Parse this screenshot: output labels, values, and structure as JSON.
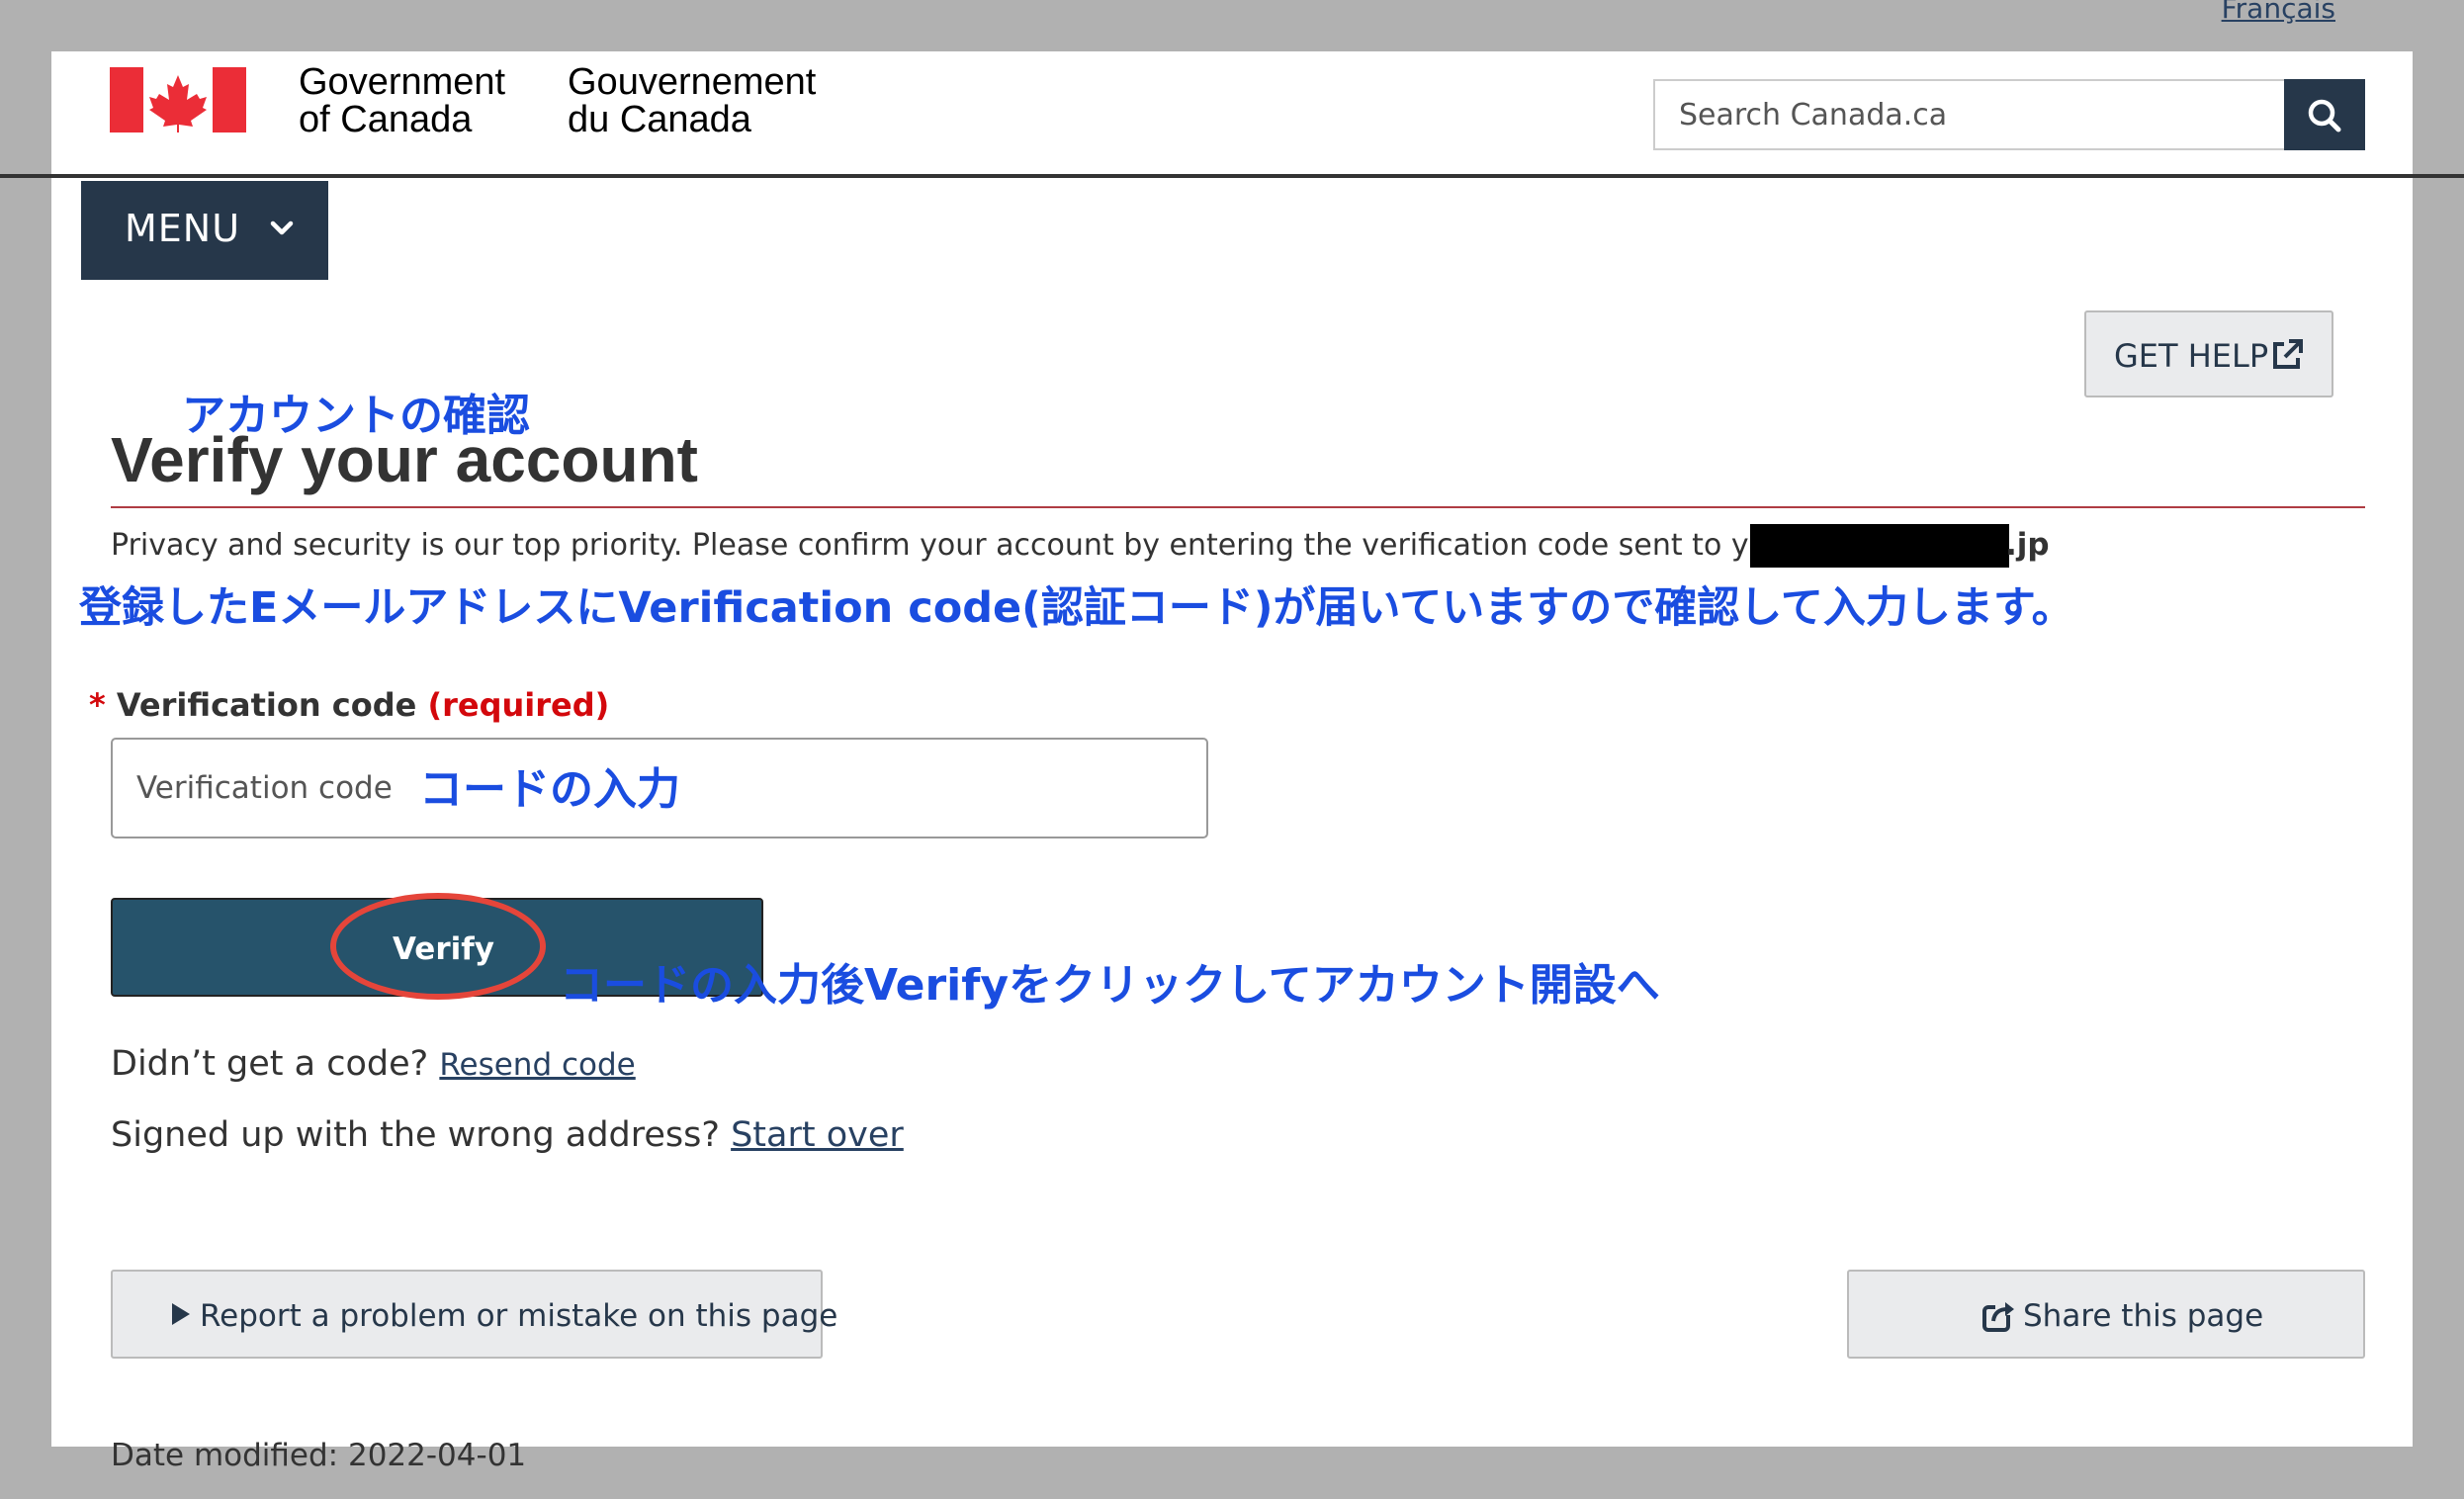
{
  "language_toggle": "Français",
  "header": {
    "signature_en": "Government\nof Canada",
    "signature_fr": "Gouvernement\ndu Canada",
    "search_placeholder": "Search Canada.ca",
    "search_icon": "search-icon"
  },
  "menu": {
    "label": "MENU",
    "icon": "chevron-down-icon"
  },
  "get_help": {
    "label": "GET HELP",
    "icon": "external-link-icon"
  },
  "annotations": {
    "title_ja": "アカウントの確認",
    "email_ja": "登録したEメールアドレスにVerification code(認証コード)が届いていますので確認して入力します。",
    "code_ja": "コードの入力",
    "verify_ja": "コードの入力後Verifyをクリックしてアカウント開設へ"
  },
  "page": {
    "title": "Verify your account",
    "privacy_text": "Privacy and security is our top priority. Please confirm your account by entering the verification code sent to your email",
    "email_suffix": ".jp"
  },
  "form": {
    "required_marker": "*",
    "label": "Verification code",
    "required_text": "(required)",
    "placeholder": "Verification code",
    "submit_label": "Verify"
  },
  "help_links": {
    "resend_prompt": "Didn’t get a code?",
    "resend_link": "Resend code",
    "wrong_address_prompt": "Signed up with the wrong address?",
    "start_over_link": "Start over"
  },
  "footer": {
    "report_label": "Report a problem or mistake on this page",
    "share_label": "Share this page",
    "share_icon": "share-icon",
    "date_modified": "Date modified: 2022-04-01"
  },
  "colors": {
    "brand_dark": "#26374a",
    "verify_button": "#26536b",
    "flag_red": "#eb2d37",
    "title_rule": "#af3c43",
    "annotation_blue": "#1a4de0",
    "annotation_ring": "#e5453a"
  }
}
